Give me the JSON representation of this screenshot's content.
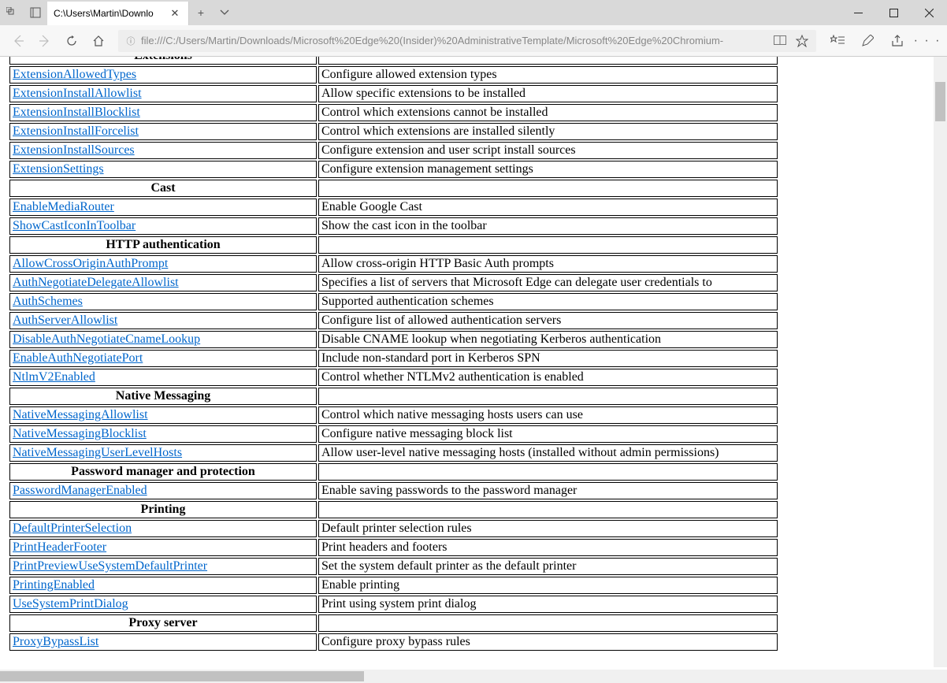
{
  "window": {
    "tab_title": "C:\\Users\\Martin\\Downlo",
    "url": "file:///C:/Users/Martin/Downloads/Microsoft%20Edge%20(Insider)%20AdministrativeTemplate/Microsoft%20Edge%20Chromium-"
  },
  "sections": [
    {
      "header": "Extensions",
      "rows": [
        {
          "name": "ExtensionAllowedTypes",
          "desc": "Configure allowed extension types"
        },
        {
          "name": "ExtensionInstallAllowlist",
          "desc": "Allow specific extensions to be installed"
        },
        {
          "name": "ExtensionInstallBlocklist",
          "desc": "Control which extensions cannot be installed"
        },
        {
          "name": "ExtensionInstallForcelist",
          "desc": "Control which extensions are installed silently"
        },
        {
          "name": "ExtensionInstallSources",
          "desc": "Configure extension and user script install sources"
        },
        {
          "name": "ExtensionSettings",
          "desc": "Configure extension management settings"
        }
      ]
    },
    {
      "header": "Cast",
      "rows": [
        {
          "name": "EnableMediaRouter",
          "desc": "Enable Google Cast"
        },
        {
          "name": "ShowCastIconInToolbar",
          "desc": "Show the cast icon in the toolbar"
        }
      ]
    },
    {
      "header": "HTTP authentication",
      "rows": [
        {
          "name": "AllowCrossOriginAuthPrompt",
          "desc": "Allow cross-origin HTTP Basic Auth prompts"
        },
        {
          "name": "AuthNegotiateDelegateAllowlist",
          "desc": "Specifies a list of servers that Microsoft Edge can delegate user credentials to"
        },
        {
          "name": "AuthSchemes",
          "desc": "Supported authentication schemes"
        },
        {
          "name": "AuthServerAllowlist",
          "desc": "Configure list of allowed authentication servers"
        },
        {
          "name": "DisableAuthNegotiateCnameLookup",
          "desc": "Disable CNAME lookup when negotiating Kerberos authentication"
        },
        {
          "name": "EnableAuthNegotiatePort",
          "desc": "Include non-standard port in Kerberos SPN"
        },
        {
          "name": "NtlmV2Enabled",
          "desc": "Control whether NTLMv2 authentication is enabled"
        }
      ]
    },
    {
      "header": "Native Messaging",
      "rows": [
        {
          "name": "NativeMessagingAllowlist",
          "desc": "Control which native messaging hosts users can use"
        },
        {
          "name": "NativeMessagingBlocklist",
          "desc": "Configure native messaging block list"
        },
        {
          "name": "NativeMessagingUserLevelHosts",
          "desc": "Allow user-level native messaging hosts (installed without admin permissions)"
        }
      ]
    },
    {
      "header": "Password manager and protection",
      "rows": [
        {
          "name": "PasswordManagerEnabled",
          "desc": "Enable saving passwords to the password manager"
        }
      ]
    },
    {
      "header": "Printing",
      "rows": [
        {
          "name": "DefaultPrinterSelection",
          "desc": "Default printer selection rules"
        },
        {
          "name": "PrintHeaderFooter",
          "desc": "Print headers and footers"
        },
        {
          "name": "PrintPreviewUseSystemDefaultPrinter",
          "desc": "Set the system default printer as the default printer"
        },
        {
          "name": "PrintingEnabled",
          "desc": "Enable printing"
        },
        {
          "name": "UseSystemPrintDialog",
          "desc": "Print using system print dialog"
        }
      ]
    },
    {
      "header": "Proxy server",
      "rows": [
        {
          "name": "ProxyBypassList",
          "desc": "Configure proxy bypass rules"
        }
      ]
    }
  ]
}
